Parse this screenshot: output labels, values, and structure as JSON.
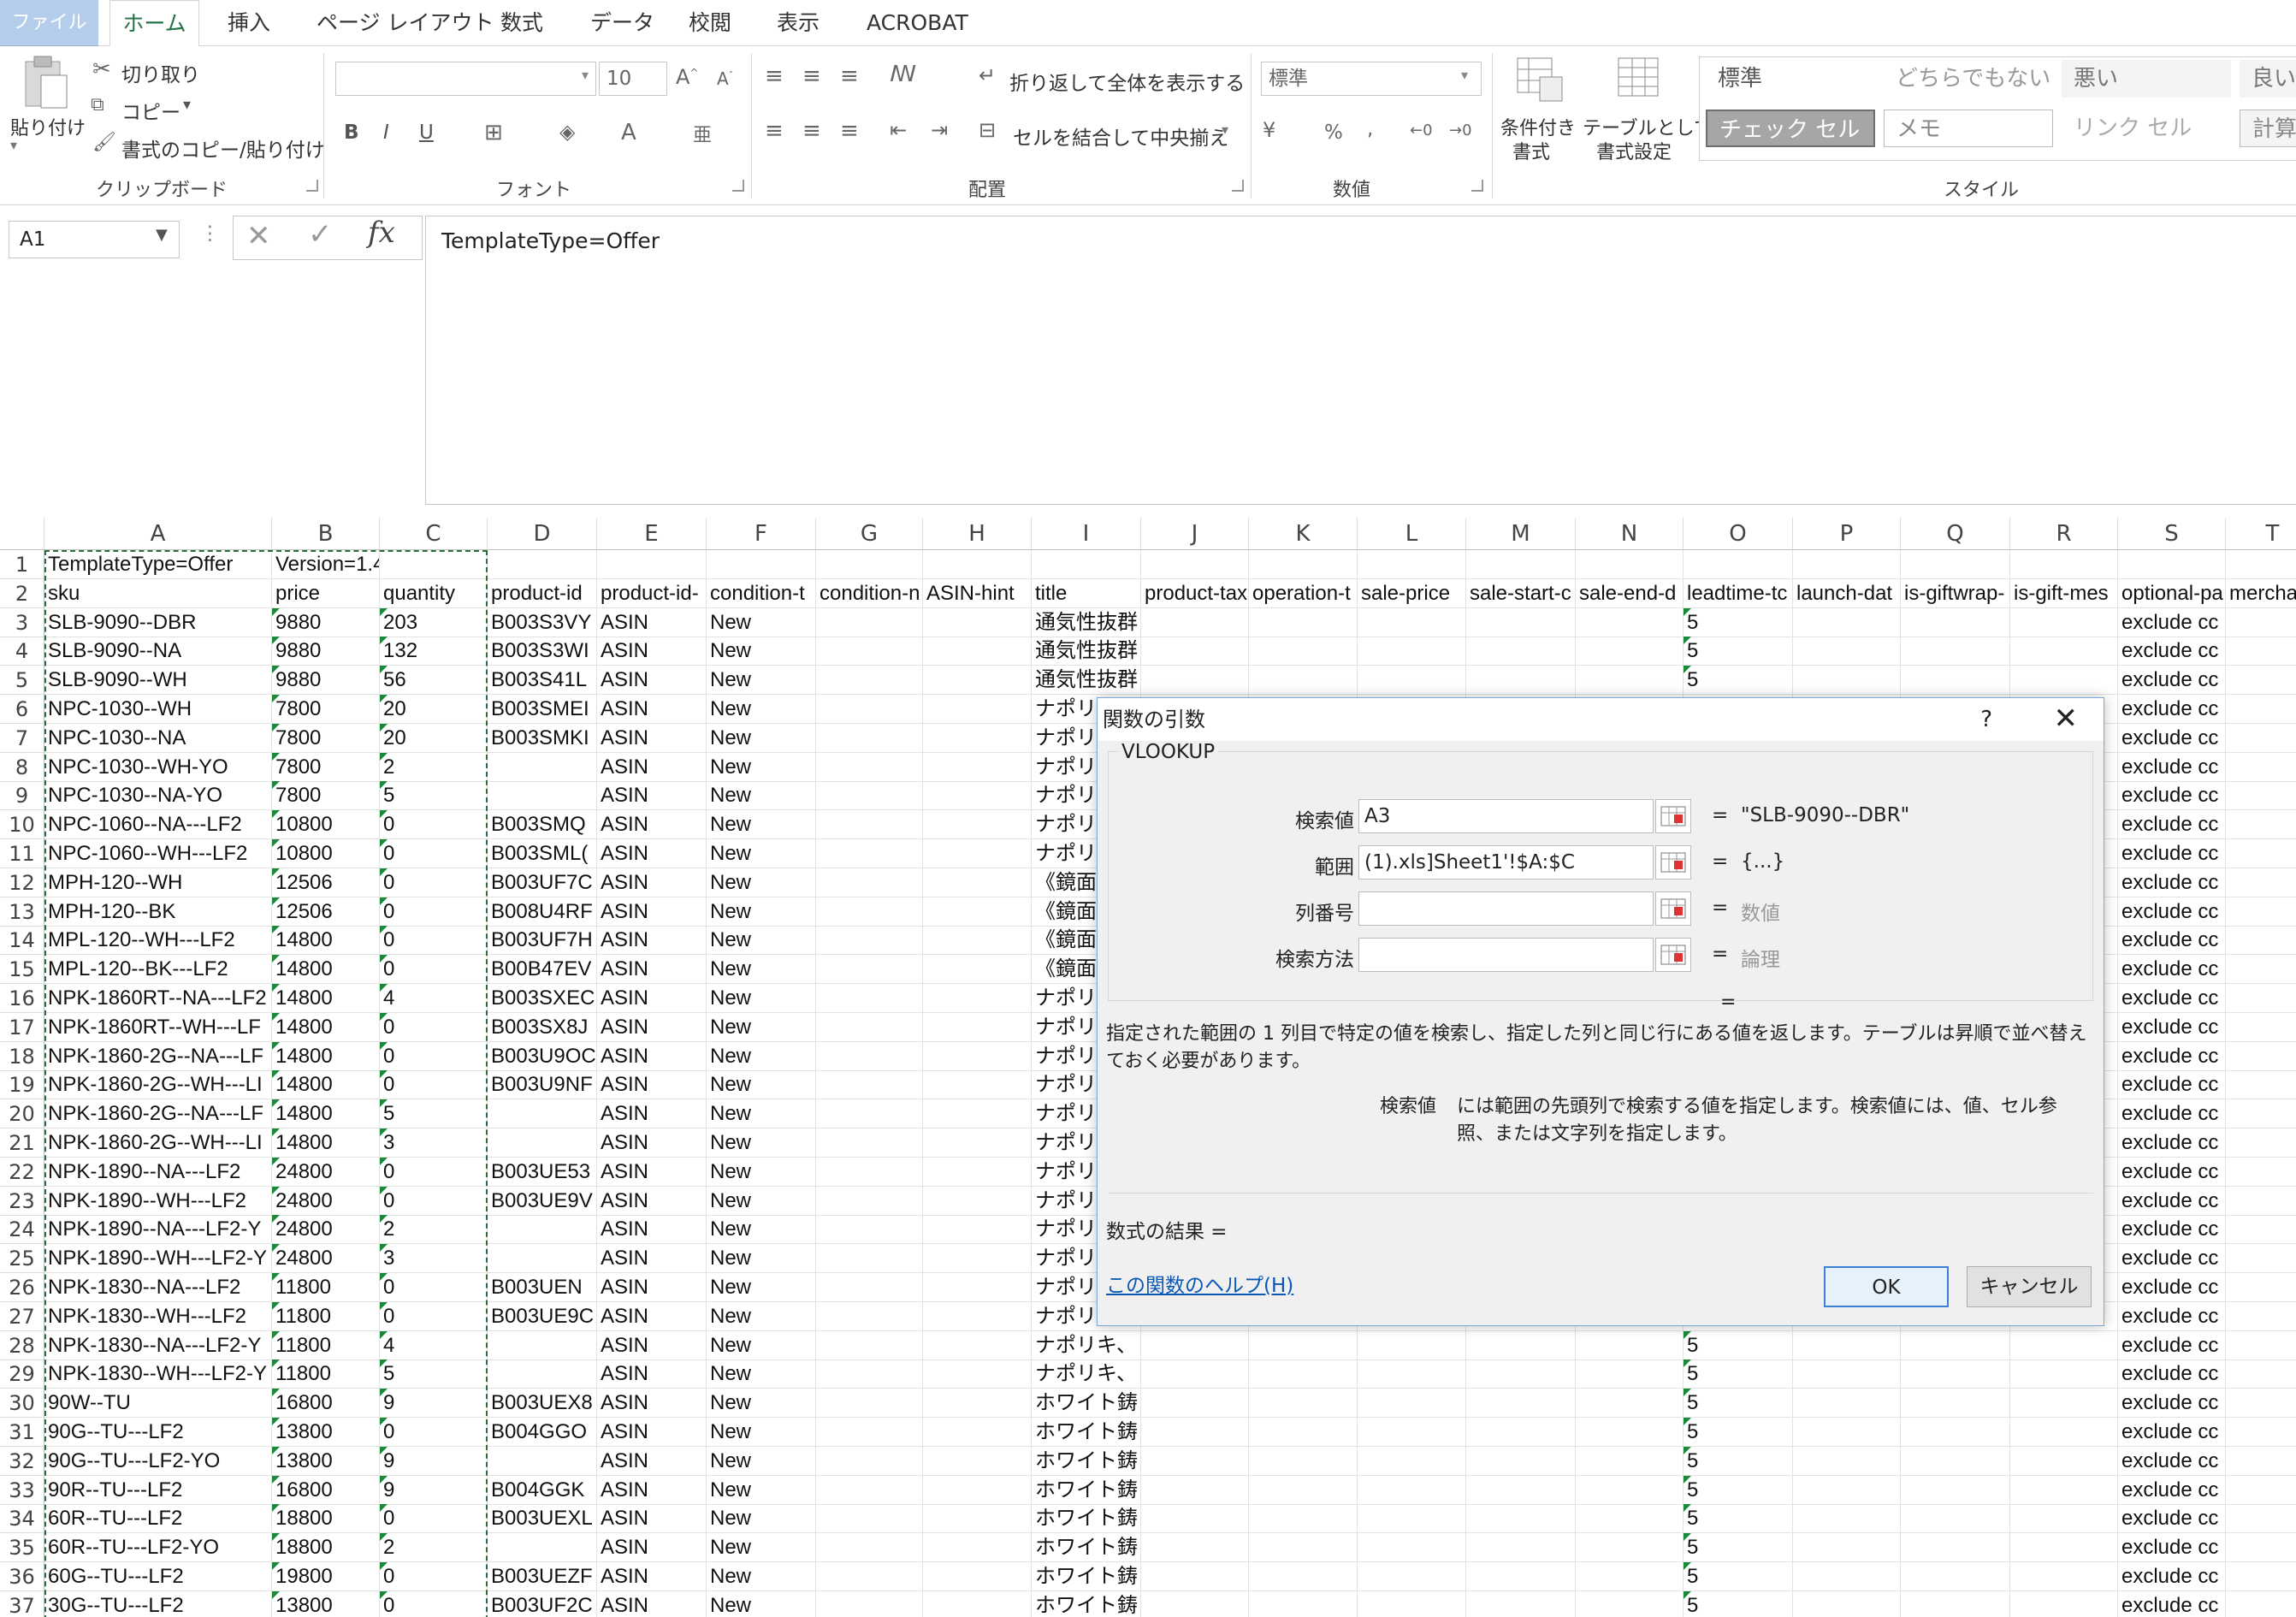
{
  "tabs": [
    "ファイル",
    "ホーム",
    "挿入",
    "ページ レイアウト",
    "数式",
    "データ",
    "校閲",
    "表示",
    "ACROBAT"
  ],
  "ribbon": {
    "clipboard": {
      "paste": "貼り付け",
      "cut": "切り取り",
      "copy": "コピー",
      "format_painter": "書式のコピー/貼り付け",
      "group": "クリップボード"
    },
    "font": {
      "size": "10",
      "bold": "B",
      "italic": "I",
      "underline": "U",
      "group": "フォント"
    },
    "alignment": {
      "wrap": "折り返して全体を表示する",
      "merge": "セルを結合して中央揃え",
      "group": "配置"
    },
    "number": {
      "format": "標準",
      "percent": "%",
      "comma": ",",
      "group": "数値"
    },
    "cond_format": {
      "line1": "条件付き",
      "line2": "書式"
    },
    "table_format": {
      "line1": "テーブルとして",
      "line2": "書式設定"
    },
    "styles": {
      "normal": "標準",
      "neutral": "どちらでもない",
      "bad": "悪い",
      "good": "良い",
      "check": "チェック セル",
      "memo": "メモ",
      "link": "リンク セル",
      "calc": "計算",
      "group": "スタイル"
    }
  },
  "formula_bar": {
    "name_box": "A1",
    "fx": "fx",
    "formula": "TemplateType=Offer"
  },
  "columns": [
    "A",
    "B",
    "C",
    "D",
    "E",
    "F",
    "G",
    "H",
    "I",
    "J",
    "K",
    "L",
    "M",
    "N",
    "O",
    "P",
    "Q",
    "R",
    "S",
    "T"
  ],
  "rows": [
    {
      "n": "1",
      "A": "TemplateType=Offer",
      "B": "Version=1.4"
    },
    {
      "n": "2",
      "A": "sku",
      "B": "price",
      "C": "quantity",
      "D": "product-id",
      "E": "product-id-",
      "F": "condition-t",
      "G": "condition-n",
      "H": "ASIN-hint",
      "I": "title",
      "J": "product-tax",
      "K": "operation-t",
      "L": "sale-price",
      "M": "sale-start-c",
      "N": "sale-end-d",
      "O": "leadtime-tc",
      "P": "launch-dat",
      "Q": "is-giftwrap-",
      "R": "is-gift-mes",
      "S": "optional-pa",
      "T": "mercha"
    },
    {
      "n": "3",
      "A": "SLB-9090--DBR",
      "B": "9880",
      "C": "203",
      "D": "B003S3VY",
      "E": "ASIN",
      "F": "New",
      "I": "通気性抜群",
      "O": "5",
      "S": "exclude cc"
    },
    {
      "n": "4",
      "A": "SLB-9090--NA",
      "B": "9880",
      "C": "132",
      "D": "B003S3WI",
      "E": "ASIN",
      "F": "New",
      "I": "通気性抜群",
      "O": "5",
      "S": "exclude cc"
    },
    {
      "n": "5",
      "A": "SLB-9090--WH",
      "B": "9880",
      "C": "56",
      "D": "B003S41L",
      "E": "ASIN",
      "F": "New",
      "I": "通気性抜群",
      "O": "5",
      "S": "exclude cc"
    },
    {
      "n": "6",
      "A": "NPC-1030--WH",
      "B": "7800",
      "C": "20",
      "D": "B003SMEI",
      "E": "ASIN",
      "F": "New",
      "I": "ナポリ",
      "S": "exclude cc"
    },
    {
      "n": "7",
      "A": "NPC-1030--NA",
      "B": "7800",
      "C": "20",
      "D": "B003SMKI",
      "E": "ASIN",
      "F": "New",
      "I": "ナポリ",
      "S": "exclude cc"
    },
    {
      "n": "8",
      "A": "NPC-1030--WH-YO",
      "B": "7800",
      "C": "2",
      "E": "ASIN",
      "F": "New",
      "I": "ナポリ",
      "S": "exclude cc"
    },
    {
      "n": "9",
      "A": "NPC-1030--NA-YO",
      "B": "7800",
      "C": "5",
      "E": "ASIN",
      "F": "New",
      "I": "ナポリ",
      "S": "exclude cc"
    },
    {
      "n": "10",
      "A": "NPC-1060--NA---LF2",
      "B": "10800",
      "C": "0",
      "D": "B003SMQ",
      "E": "ASIN",
      "F": "New",
      "I": "ナポリ",
      "S": "exclude cc"
    },
    {
      "n": "11",
      "A": "NPC-1060--WH---LF2",
      "B": "10800",
      "C": "0",
      "D": "B003SML(",
      "E": "ASIN",
      "F": "New",
      "I": "ナポリ",
      "S": "exclude cc"
    },
    {
      "n": "12",
      "A": "MPH-120--WH",
      "B": "12506",
      "C": "0",
      "D": "B003UF7C",
      "E": "ASIN",
      "F": "New",
      "I": "《鏡面",
      "S": "exclude cc"
    },
    {
      "n": "13",
      "A": "MPH-120--BK",
      "B": "12506",
      "C": "0",
      "D": "B008U4RF",
      "E": "ASIN",
      "F": "New",
      "I": "《鏡面",
      "S": "exclude cc"
    },
    {
      "n": "14",
      "A": "MPL-120--WH---LF2",
      "B": "14800",
      "C": "0",
      "D": "B003UF7H",
      "E": "ASIN",
      "F": "New",
      "I": "《鏡面",
      "S": "exclude cc"
    },
    {
      "n": "15",
      "A": "MPL-120--BK---LF2",
      "B": "14800",
      "C": "0",
      "D": "B00B47EV",
      "E": "ASIN",
      "F": "New",
      "I": "《鏡面",
      "S": "exclude cc"
    },
    {
      "n": "16",
      "A": "NPK-1860RT--NA---LF2",
      "B": "14800",
      "C": "4",
      "D": "B003SXEC",
      "E": "ASIN",
      "F": "New",
      "I": "ナポリ",
      "S": "exclude cc"
    },
    {
      "n": "17",
      "A": "NPK-1860RT--WH---LF",
      "B": "14800",
      "C": "0",
      "D": "B003SX8J",
      "E": "ASIN",
      "F": "New",
      "I": "ナポリ",
      "S": "exclude cc"
    },
    {
      "n": "18",
      "A": "NPK-1860-2G--NA---LF",
      "B": "14800",
      "C": "0",
      "D": "B003U9OC",
      "E": "ASIN",
      "F": "New",
      "I": "ナポリ",
      "S": "exclude cc"
    },
    {
      "n": "19",
      "A": "NPK-1860-2G--WH---LI",
      "B": "14800",
      "C": "0",
      "D": "B003U9NF",
      "E": "ASIN",
      "F": "New",
      "I": "ナポリ",
      "S": "exclude cc"
    },
    {
      "n": "20",
      "A": "NPK-1860-2G--NA---LF",
      "B": "14800",
      "C": "5",
      "E": "ASIN",
      "F": "New",
      "I": "ナポリ",
      "S": "exclude cc"
    },
    {
      "n": "21",
      "A": "NPK-1860-2G--WH---LI",
      "B": "14800",
      "C": "3",
      "E": "ASIN",
      "F": "New",
      "I": "ナポリ",
      "S": "exclude cc"
    },
    {
      "n": "22",
      "A": "NPK-1890--NA---LF2",
      "B": "24800",
      "C": "0",
      "D": "B003UE53",
      "E": "ASIN",
      "F": "New",
      "I": "ナポリ",
      "S": "exclude cc"
    },
    {
      "n": "23",
      "A": "NPK-1890--WH---LF2",
      "B": "24800",
      "C": "0",
      "D": "B003UE9V",
      "E": "ASIN",
      "F": "New",
      "I": "ナポリ",
      "S": "exclude cc"
    },
    {
      "n": "24",
      "A": "NPK-1890--NA---LF2-Y",
      "B": "24800",
      "C": "2",
      "E": "ASIN",
      "F": "New",
      "I": "ナポリ",
      "S": "exclude cc"
    },
    {
      "n": "25",
      "A": "NPK-1890--WH---LF2-Y",
      "B": "24800",
      "C": "3",
      "E": "ASIN",
      "F": "New",
      "I": "ナポリ",
      "S": "exclude cc"
    },
    {
      "n": "26",
      "A": "NPK-1830--NA---LF2",
      "B": "11800",
      "C": "0",
      "D": "B003UEN",
      "E": "ASIN",
      "F": "New",
      "I": "ナポリ",
      "S": "exclude cc"
    },
    {
      "n": "27",
      "A": "NPK-1830--WH---LF2",
      "B": "11800",
      "C": "0",
      "D": "B003UE9C",
      "E": "ASIN",
      "F": "New",
      "I": "ナポリ",
      "S": "exclude cc"
    },
    {
      "n": "28",
      "A": "NPK-1830--NA---LF2-Y",
      "B": "11800",
      "C": "4",
      "E": "ASIN",
      "F": "New",
      "I": "ナポリキ、",
      "O": "5",
      "S": "exclude cc"
    },
    {
      "n": "29",
      "A": "NPK-1830--WH---LF2-Y",
      "B": "11800",
      "C": "5",
      "E": "ASIN",
      "F": "New",
      "I": "ナポリキ、",
      "O": "5",
      "S": "exclude cc"
    },
    {
      "n": "30",
      "A": "90W--TU",
      "B": "16800",
      "C": "9",
      "D": "B003UEX8",
      "E": "ASIN",
      "F": "New",
      "I": "ホワイト鋳",
      "O": "5",
      "S": "exclude cc"
    },
    {
      "n": "31",
      "A": "90G--TU---LF2",
      "B": "13800",
      "C": "0",
      "D": "B004GGO",
      "E": "ASIN",
      "F": "New",
      "I": "ホワイト鋳",
      "O": "5",
      "S": "exclude cc"
    },
    {
      "n": "32",
      "A": "90G--TU---LF2-YO",
      "B": "13800",
      "C": "9",
      "E": "ASIN",
      "F": "New",
      "I": "ホワイト鋳",
      "O": "5",
      "S": "exclude cc"
    },
    {
      "n": "33",
      "A": "90R--TU---LF2",
      "B": "16800",
      "C": "9",
      "D": "B004GGK",
      "E": "ASIN",
      "F": "New",
      "I": "ホワイト鋳",
      "O": "5",
      "S": "exclude cc"
    },
    {
      "n": "34",
      "A": "60R--TU---LF2",
      "B": "18800",
      "C": "0",
      "D": "B003UEXL",
      "E": "ASIN",
      "F": "New",
      "I": "ホワイト鋳",
      "O": "5",
      "S": "exclude cc"
    },
    {
      "n": "35",
      "A": "60R--TU---LF2-YO",
      "B": "18800",
      "C": "2",
      "E": "ASIN",
      "F": "New",
      "I": "ホワイト鋳",
      "O": "5",
      "S": "exclude cc"
    },
    {
      "n": "36",
      "A": "60G--TU---LF2",
      "B": "19800",
      "C": "0",
      "D": "B003UEZF",
      "E": "ASIN",
      "F": "New",
      "I": "ホワイト鋳",
      "O": "5",
      "S": "exclude cc"
    },
    {
      "n": "37",
      "A": "30G--TU---LF2",
      "B": "13800",
      "C": "0",
      "D": "B003UF2C",
      "E": "ASIN",
      "F": "New",
      "I": "ホワイト鋳",
      "O": "5",
      "S": "exclude cc"
    }
  ],
  "dialog": {
    "title": "関数の引数",
    "help_q": "?",
    "close": "✕",
    "function": "VLOOKUP",
    "args": [
      {
        "label": "検索値",
        "value": "A3",
        "eq": "=",
        "result": "\"SLB-9090--DBR\"",
        "dim": false
      },
      {
        "label": "範囲",
        "value": "(1).xls]Sheet1'!$A:$C",
        "eq": "=",
        "result": "{...}",
        "dim": false
      },
      {
        "label": "列番号",
        "value": "",
        "eq": "=",
        "result": "数値",
        "dim": true
      },
      {
        "label": "検索方法",
        "value": "",
        "eq": "=",
        "result": "論理",
        "dim": true
      }
    ],
    "eq_alone": "=",
    "description": "指定された範囲の 1 列目で特定の値を検索し、指定した列と同じ行にある値を返します。テーブルは昇順で並べ替えておく必要があります。",
    "arg_help_label": "検索値",
    "arg_help_text": "には範囲の先頭列で検索する値を指定します。検索値には、値、セル参照、または文字列を指定します。",
    "result_label": "数式の結果 =",
    "help_link": "この関数のヘルプ(H)",
    "ok": "OK",
    "cancel": "キャンセル"
  }
}
